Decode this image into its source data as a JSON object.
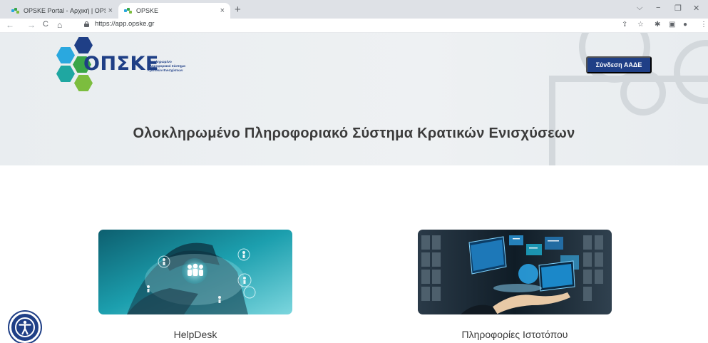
{
  "browser": {
    "tabs": [
      {
        "title": "OPSKE Portal - Αρχική | OPSKE P",
        "close": "×"
      },
      {
        "title": "OPSKE",
        "close": "×"
      }
    ],
    "new_tab": "+",
    "window_controls": {
      "minimize": "−",
      "restore": "❐",
      "close": "✕",
      "dropdown": "⌵"
    },
    "nav": {
      "back": "←",
      "forward": "→",
      "reload": "C",
      "home": "⌂"
    },
    "url": "https://app.opske.gr",
    "toolbar_icons": {
      "share": "⇪",
      "bookmark": "☆",
      "extensions": "✱",
      "sidebar": "▣",
      "profile": "●",
      "menu": "⋮"
    }
  },
  "header": {
    "logo_text": "ΟΠΣΚΕ",
    "logo_subtitle": "Ολοκληρωμένο\nΠληροφοριακό Σύστημα\nΚρατικών Ενισχύσεων",
    "login_button": "Σύνδεση ΑΑΔΕ"
  },
  "hero": {
    "title": "Ολοκληρωμένο Πληροφοριακό Σύστημα Κρατικών Ενισχύσεων"
  },
  "cards": [
    {
      "label": "HelpDesk"
    },
    {
      "label": "Πληροφορίες Ιστοτόπου"
    }
  ],
  "colors": {
    "brand_blue": "#1f3f86",
    "hex_navy": "#1f3f86",
    "hex_sky": "#2aa8df",
    "hex_teal": "#1fa7a1",
    "hex_green": "#3aa648",
    "hex_lime": "#7cbd3e"
  }
}
